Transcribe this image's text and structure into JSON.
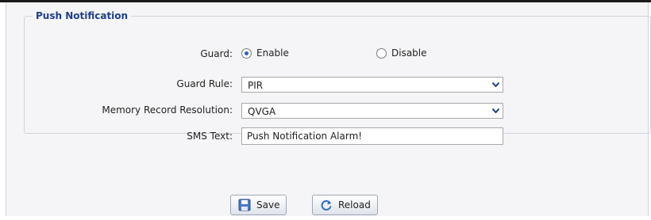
{
  "section": {
    "title": "Push Notification"
  },
  "guard": {
    "label": "Guard:",
    "options": [
      {
        "label": "Enable",
        "checked": true
      },
      {
        "label": "Disable",
        "checked": false
      }
    ]
  },
  "guard_rule": {
    "label": "Guard Rule:",
    "value": "PIR",
    "icon": "chevron-down-icon"
  },
  "memory_record_resolution": {
    "label": "Memory Record Resolution:",
    "value": "QVGA",
    "icon": "chevron-down-icon"
  },
  "sms_text": {
    "label": "SMS Text:",
    "value": "Push Notification Alarm!"
  },
  "buttons": {
    "save": {
      "label": "Save",
      "icon": "floppy-disk-icon"
    },
    "reload": {
      "label": "Reload",
      "icon": "refresh-icon"
    }
  },
  "colors": {
    "accent": "#1e3f8a",
    "panel_bg": "#f5f5f7",
    "border": "#d0d3dc"
  }
}
